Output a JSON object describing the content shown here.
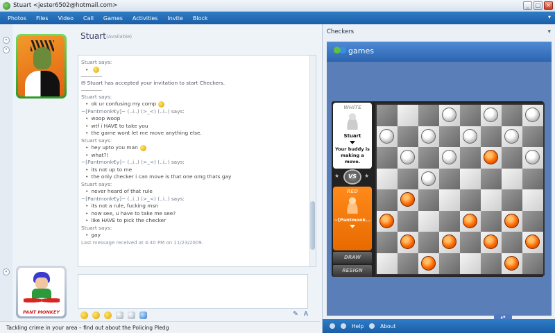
{
  "window": {
    "title": "Stuart <jester6502@hotmail.com>",
    "buttons": [
      "_",
      "□",
      "×"
    ]
  },
  "menu": {
    "items": [
      "Photos",
      "Files",
      "Video",
      "Call",
      "Games",
      "Activities",
      "Invite",
      "Block"
    ],
    "right_glyph": "▾"
  },
  "contact": {
    "name": "Stuart",
    "status": "(Available)"
  },
  "chat": {
    "lines": [
      {
        "kind": "says",
        "text": "Stuart says:"
      },
      {
        "kind": "msg",
        "text": ""
      },
      {
        "kind": "sys",
        "text": "Stuart has accepted your invitation to start Checkers."
      },
      {
        "kind": "says",
        "text": "Stuart says:"
      },
      {
        "kind": "msg",
        "text": "ok ur confusing my comp"
      },
      {
        "kind": "says",
        "text": "~[Pantmonk€y]~ (..i..) (>_<) (..i..) says:"
      },
      {
        "kind": "msg",
        "text": "woop woop"
      },
      {
        "kind": "msg",
        "text": "wtf i HAVE to take you"
      },
      {
        "kind": "msg",
        "text": "the game wont let me move anything else."
      },
      {
        "kind": "says",
        "text": "Stuart says:"
      },
      {
        "kind": "msg",
        "text": "hey upto you man"
      },
      {
        "kind": "msg",
        "text": "what?!"
      },
      {
        "kind": "says",
        "text": "~[Pantmonk€y]~ (..i..) (>_<) (..i..) says:"
      },
      {
        "kind": "msg",
        "text": "its not up to me"
      },
      {
        "kind": "msg",
        "text": "the only checker i can move is that one omg thats gay"
      },
      {
        "kind": "says",
        "text": "Stuart says:"
      },
      {
        "kind": "msg",
        "text": "never heard of that rule"
      },
      {
        "kind": "says",
        "text": "~[Pantmonk€y]~ (..i..) (>_<) (..i..) says:"
      },
      {
        "kind": "msg",
        "text": "its not a rule, fucking msn"
      },
      {
        "kind": "msg",
        "text": "now see, u have to take me see?"
      },
      {
        "kind": "msg",
        "text": "like HAVE to pick the checker"
      },
      {
        "kind": "says",
        "text": "Stuart says:"
      },
      {
        "kind": "msg",
        "text": "gay"
      }
    ],
    "last_received": "Last message received at 4:40 PM on 11/23/2009."
  },
  "avatar_bottom_label": "PANT MONKEY",
  "compose": {
    "right_tools": [
      "✎",
      "A"
    ]
  },
  "status_news": "Tackling crime in your area – find out about the Policing Pledg",
  "games_panel": {
    "title": "Checkers",
    "header": "games",
    "close_glyph": "▾",
    "white_label": "WHITE",
    "white_player": "Stuart",
    "white_status": "Your buddy is making a move.",
    "vs": "VS",
    "red_label": "RED",
    "red_player": "~[Pantmonk...",
    "draw_button": "DRAW",
    "resign_button": "RESIGN",
    "help_link": "Help",
    "about_link": "About"
  },
  "board": {
    "rows": [
      [
        "",
        "",
        "",
        "W",
        "",
        "W",
        "",
        "W"
      ],
      [
        "W",
        "",
        "W",
        "",
        "W",
        "",
        "W",
        ""
      ],
      [
        "",
        "W",
        "",
        "W",
        "",
        "R",
        "",
        "W"
      ],
      [
        "",
        "",
        "W",
        "",
        "",
        "",
        "",
        ""
      ],
      [
        "",
        "R",
        "",
        "",
        "",
        "",
        "",
        ""
      ],
      [
        "R",
        "",
        "",
        "",
        "R",
        "",
        "R",
        ""
      ],
      [
        "",
        "R",
        "",
        "R",
        "",
        "R",
        "",
        "R"
      ],
      [
        "",
        "",
        "R",
        "",
        "",
        "",
        "R",
        ""
      ]
    ]
  }
}
